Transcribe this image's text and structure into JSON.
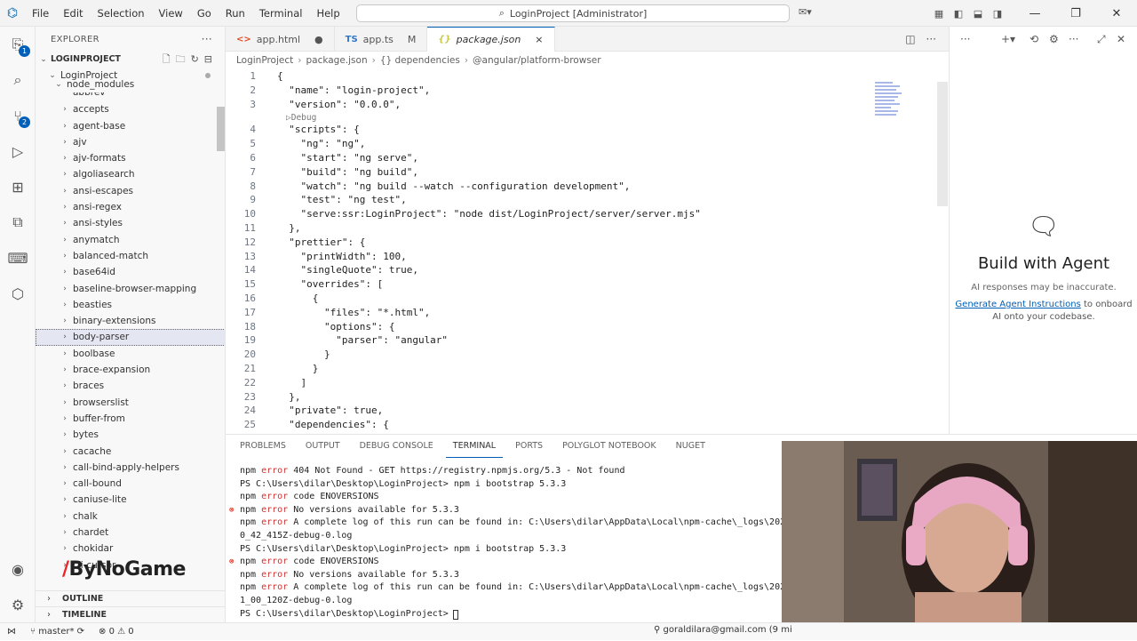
{
  "titlebar": {
    "menu": [
      "File",
      "Edit",
      "Selection",
      "View",
      "Go",
      "Run",
      "Terminal",
      "Help"
    ],
    "command_center": "LoginProject [Administrator]"
  },
  "sidebar": {
    "header": "EXPLORER",
    "root": "LOGINPROJECT",
    "folder": "LoginProject",
    "subfolder": "node_modules",
    "partial_top": "abbrev",
    "items": [
      "accepts",
      "agent-base",
      "ajv",
      "ajv-formats",
      "algoliasearch",
      "ansi-escapes",
      "ansi-regex",
      "ansi-styles",
      "anymatch",
      "balanced-match",
      "base64id",
      "baseline-browser-mapping",
      "beasties",
      "binary-extensions",
      "body-parser",
      "boolbase",
      "brace-expansion",
      "braces",
      "browserslist",
      "buffer-from",
      "bytes",
      "cacache",
      "call-bind-apply-helpers",
      "call-bound",
      "caniuse-lite",
      "chalk",
      "chardet",
      "chokidar",
      "cli-cursor"
    ],
    "selected_index": 14,
    "outline": "OUTLINE",
    "timeline": "TIMELINE"
  },
  "watermark": {
    "prefix": "/",
    "brand": "ByNoGame"
  },
  "tabs": [
    {
      "label": "app.html",
      "icon": "<>",
      "color": "#e44d26",
      "state": "●"
    },
    {
      "label": "app.ts",
      "icon": "TS",
      "color": "#3178c6",
      "state": "M"
    },
    {
      "label": "package.json",
      "icon": "{}",
      "color": "#cbcb41",
      "state": "×",
      "active": true
    }
  ],
  "breadcrumb": [
    "LoginProject",
    "package.json",
    "{} dependencies",
    "@angular/platform-browser"
  ],
  "code": {
    "codelens": "▷Debug",
    "lines": [
      {
        "n": "1",
        "t": "{"
      },
      {
        "n": "2",
        "t": "  \"name\": \"login-project\","
      },
      {
        "n": "3",
        "t": "  \"version\": \"0.0.0\","
      },
      {
        "n": "4",
        "t": "  \"scripts\": {"
      },
      {
        "n": "5",
        "t": "    \"ng\": \"ng\","
      },
      {
        "n": "6",
        "t": "    \"start\": \"ng serve\","
      },
      {
        "n": "7",
        "t": "    \"build\": \"ng build\","
      },
      {
        "n": "8",
        "t": "    \"watch\": \"ng build --watch --configuration development\","
      },
      {
        "n": "9",
        "t": "    \"test\": \"ng test\","
      },
      {
        "n": "10",
        "t": "    \"serve:ssr:LoginProject\": \"node dist/LoginProject/server/server.mjs\""
      },
      {
        "n": "11",
        "t": "  },"
      },
      {
        "n": "12",
        "t": "  \"prettier\": {"
      },
      {
        "n": "13",
        "t": "    \"printWidth\": 100,"
      },
      {
        "n": "14",
        "t": "    \"singleQuote\": true,"
      },
      {
        "n": "15",
        "t": "    \"overrides\": ["
      },
      {
        "n": "16",
        "t": "      {"
      },
      {
        "n": "17",
        "t": "        \"files\": \"*.html\","
      },
      {
        "n": "18",
        "t": "        \"options\": {"
      },
      {
        "n": "19",
        "t": "          \"parser\": \"angular\""
      },
      {
        "n": "20",
        "t": "        }"
      },
      {
        "n": "21",
        "t": "      }"
      },
      {
        "n": "22",
        "t": "    ]"
      },
      {
        "n": "23",
        "t": "  },"
      },
      {
        "n": "24",
        "t": "  \"private\": true,"
      },
      {
        "n": "25",
        "t": "  \"dependencies\": {"
      }
    ]
  },
  "panel": {
    "tabs": [
      "PROBLEMS",
      "OUTPUT",
      "DEBUG CONSOLE",
      "TERMINAL",
      "PORTS",
      "POLYGLOT NOTEBOOK",
      "NUGET"
    ],
    "active_tab": "TERMINAL",
    "terminal_lines": [
      {
        "t": "npm error 404 Not Found - GET https://registry.npmjs.org/5.3 - Not found",
        "err": false
      },
      {
        "t": "PS C:\\Users\\dilar\\Desktop\\LoginProject> npm i bootstrap 5.3.3",
        "err": false
      },
      {
        "t": "npm error code ENOVERSIONS",
        "err": false
      },
      {
        "t": "npm error No versions available for 5.3.3",
        "err": true
      },
      {
        "t": "npm error A complete log of this run can be found in: C:\\Users\\dilar\\AppData\\Local\\npm-cache\\_logs\\202",
        "err": false
      },
      {
        "t": "0_42_415Z-debug-0.log",
        "err": false
      },
      {
        "t": "PS C:\\Users\\dilar\\Desktop\\LoginProject> npm i bootstrap 5.3.3",
        "err": false
      },
      {
        "t": "npm error code ENOVERSIONS",
        "err": true
      },
      {
        "t": "npm error No versions available for 5.3.3",
        "err": false
      },
      {
        "t": "npm error A complete log of this run can be found in: C:\\Users\\dilar\\AppData\\Local\\npm-cache\\_logs\\202",
        "err": false
      },
      {
        "t": "1_00_120Z-debug-0.log",
        "err": false
      },
      {
        "t": "PS C:\\Users\\dilar\\Desktop\\LoginProject> ",
        "err": false
      }
    ]
  },
  "chat": {
    "title": "Build with Agent",
    "subtitle": "AI responses may be inaccurate.",
    "link": "Generate Agent Instructions",
    "link_suffix": " to onboard AI onto your codebase."
  },
  "statusbar": {
    "branch": "master*",
    "problems": "⊗ 0 ⚠ 0",
    "account": "goraldilara@gmail.com (9 mi"
  }
}
